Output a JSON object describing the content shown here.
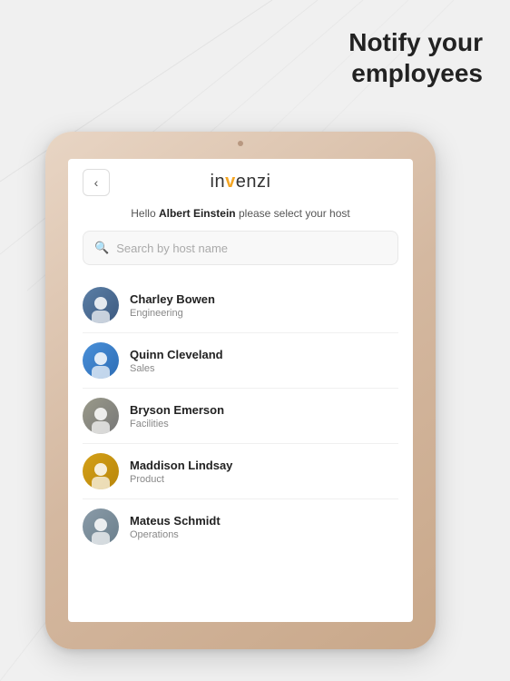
{
  "background": {
    "headline_line1": "Notify your",
    "headline_line2": "employees"
  },
  "tablet": {
    "header": {
      "back_label": "<",
      "logo_prefix": "in",
      "logo_accent": "v",
      "logo_suffix": "enzi"
    },
    "greeting": {
      "prefix": "Hello ",
      "name": "Albert Einstein",
      "suffix": " please select your host"
    },
    "search": {
      "placeholder": "Search by host name"
    },
    "people": [
      {
        "id": "charley",
        "name": "Charley Bowen",
        "dept": "Engineering"
      },
      {
        "id": "quinn",
        "name": "Quinn Cleveland",
        "dept": "Sales"
      },
      {
        "id": "bryson",
        "name": "Bryson Emerson",
        "dept": "Facilities"
      },
      {
        "id": "maddison",
        "name": "Maddison Lindsay",
        "dept": "Product"
      },
      {
        "id": "mateus",
        "name": "Mateus Schmidt",
        "dept": "Operations"
      }
    ]
  }
}
